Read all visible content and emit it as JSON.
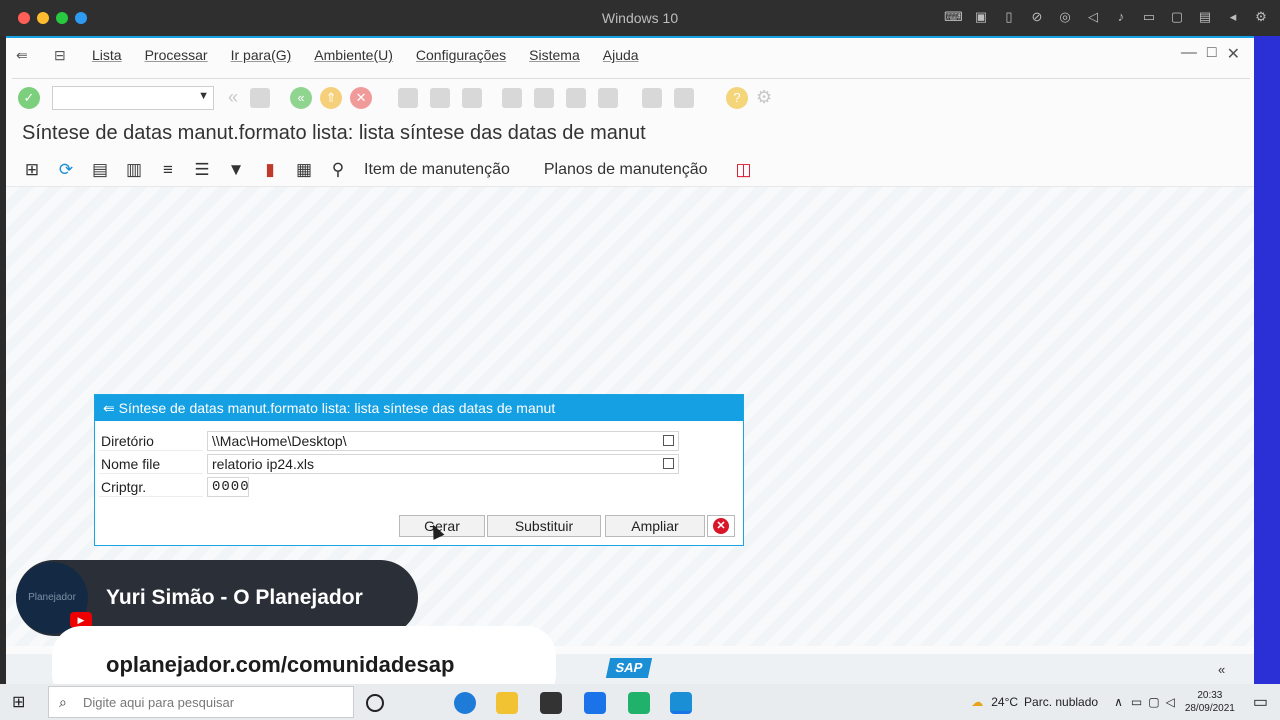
{
  "mac": {
    "title": "Windows 10"
  },
  "menu": [
    "Lista",
    "Processar",
    "Ir para(G)",
    "Ambiente(U)",
    "Configurações",
    "Sistema",
    "Ajuda"
  ],
  "page_title": "Síntese de datas manut.formato lista: lista síntese das datas de manut",
  "toolbar2": {
    "item_button": "Item de manutenção",
    "plans_button": "Planos de manutenção"
  },
  "dialog": {
    "title": "Síntese de datas manut.formato lista: lista síntese das datas de manut",
    "fields": [
      {
        "label": "Diretório",
        "value": "\\\\Mac\\Home\\Desktop\\"
      },
      {
        "label": "Nome file",
        "value": "relatorio ip24.xls"
      },
      {
        "label": "Criptgr.",
        "value": "0000"
      }
    ],
    "buttons": {
      "generate": "Gerar",
      "replace": "Substituir",
      "extend": "Ampliar"
    }
  },
  "overlay": {
    "name": "Yuri Simão - O Planejador",
    "url": "oplanejador.com/comunidadesap",
    "avatar_text": "Planejador"
  },
  "taskbar": {
    "search_placeholder": "Digite aqui para pesquisar",
    "temperature": "24°C",
    "weather": "Parc. nublado",
    "time": "20:33",
    "date": "28/09/2021"
  },
  "colors": {
    "accent": "#14a0e3",
    "cancel": "#d9152a",
    "sap_logo": "#1a8fd6"
  }
}
